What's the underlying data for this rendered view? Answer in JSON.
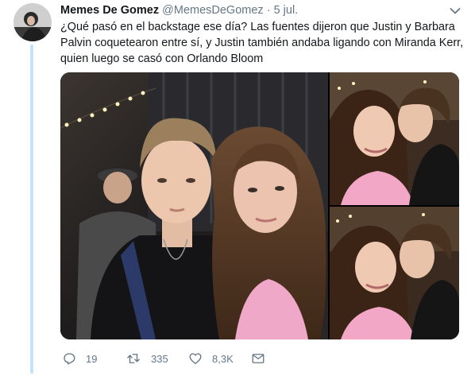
{
  "tweet": {
    "author_name": "Memes De Gomez",
    "author_handle": "@MemesDeGomez",
    "separator": "·",
    "date": "5 jul.",
    "text_lines": [
      "¿Qué pasó en el backstage ese día? Las fuentes dijeron que Justin y Barbara",
      "Palvin coquetearon entre sí,  y Justin también andaba ligando con Miranda Kerr,",
      "quien luego se casó con Orlando Bloom"
    ]
  },
  "media": {
    "photos": [
      {
        "name": "backstage-selfie-photo"
      },
      {
        "name": "kiss-photo-1"
      },
      {
        "name": "kiss-photo-2"
      }
    ]
  },
  "actions": {
    "reply": {
      "icon": "reply-icon",
      "count": "19"
    },
    "retweet": {
      "icon": "retweet-icon",
      "count": "335"
    },
    "like": {
      "icon": "heart-icon",
      "count": "8,3K"
    },
    "dm": {
      "icon": "envelope-icon"
    }
  },
  "colors": {
    "thread_line": "#c4e3f5",
    "secondary_text": "#657786",
    "primary_text": "#14171a"
  }
}
